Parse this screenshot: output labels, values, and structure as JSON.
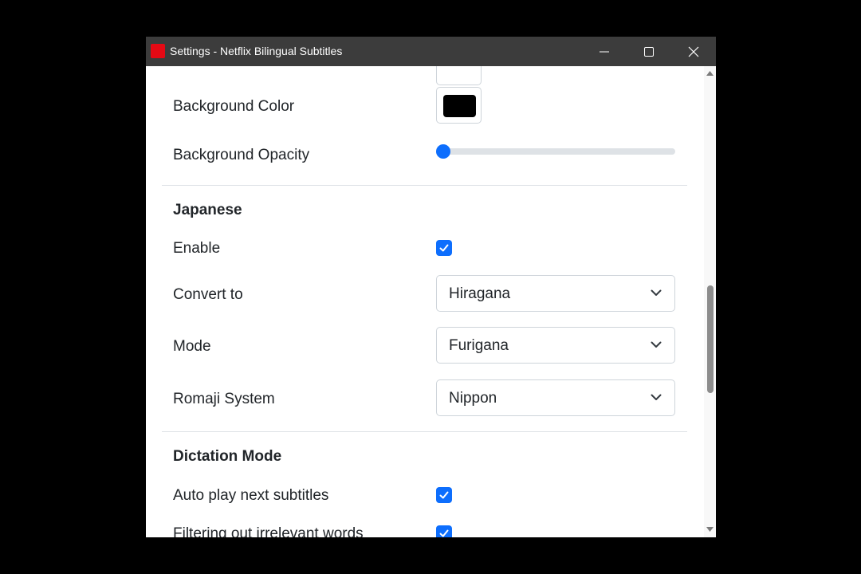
{
  "window": {
    "title": "Settings - Netflix Bilingual Subtitles",
    "brand_color": "#e50914",
    "buttons": [
      "minimize-icon",
      "maximize-icon",
      "close-icon"
    ]
  },
  "appearance": {
    "background_color_label": "Background Color",
    "background_color_value": "#000000",
    "background_opacity_label": "Background Opacity",
    "background_opacity_value": 0
  },
  "japanese": {
    "heading": "Japanese",
    "enable_label": "Enable",
    "enable_checked": true,
    "convert_to_label": "Convert to",
    "convert_to_value": "Hiragana",
    "mode_label": "Mode",
    "mode_value": "Furigana",
    "romaji_label": "Romaji System",
    "romaji_value": "Nippon"
  },
  "dictation": {
    "heading": "Dictation Mode",
    "auto_play_label": "Auto play next subtitles",
    "auto_play_checked": true,
    "filtering_label": "Filtering out irrelevant words",
    "filtering_checked": true
  },
  "colors": {
    "accent": "#0d6efd",
    "titlebar": "#3c3c3c"
  }
}
